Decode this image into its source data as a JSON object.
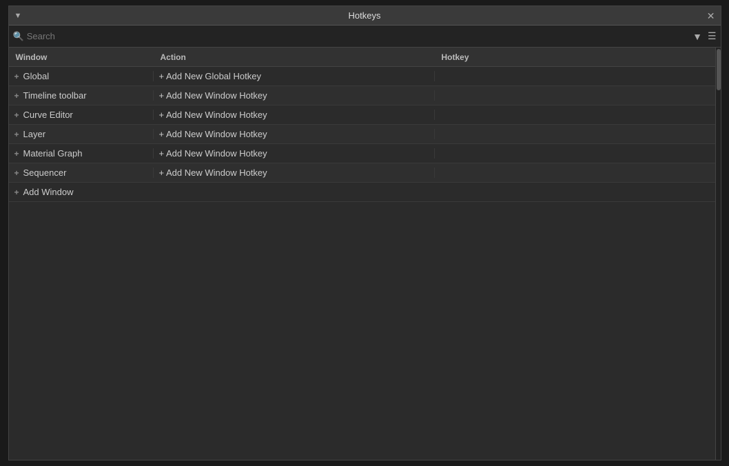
{
  "dialog": {
    "title": "Hotkeys"
  },
  "header": {
    "dropdown_icon": "▼",
    "close_icon": "✕"
  },
  "search": {
    "placeholder": "Search"
  },
  "columns": {
    "window": "Window",
    "action": "Action",
    "hotkey": "Hotkey"
  },
  "rows": [
    {
      "window": "Global",
      "action_label": "+ Add New Global Hotkey",
      "hotkey": "",
      "is_global": true
    },
    {
      "window": "Timeline toolbar",
      "action_label": "+ Add New Window Hotkey",
      "hotkey": ""
    },
    {
      "window": "Curve Editor",
      "action_label": "+ Add New Window Hotkey",
      "hotkey": ""
    },
    {
      "window": "Layer",
      "action_label": "+ Add New Window Hotkey",
      "hotkey": ""
    },
    {
      "window": "Material Graph",
      "action_label": "+ Add New Window Hotkey",
      "hotkey": ""
    },
    {
      "window": "Sequencer",
      "action_label": "+ Add New Window Hotkey",
      "hotkey": ""
    }
  ],
  "add_window": {
    "label": "Add Window"
  },
  "icons": {
    "search": "🔍",
    "filter": "⚟",
    "menu": "☰",
    "plus": "+"
  }
}
